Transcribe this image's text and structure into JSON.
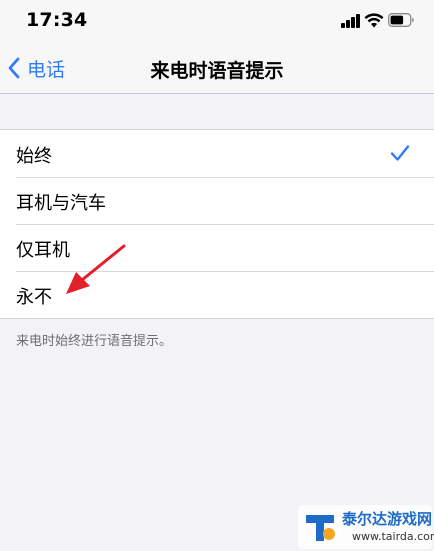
{
  "status_bar": {
    "time": "17:34",
    "icons": [
      "signal-icon",
      "wifi-icon",
      "battery-icon"
    ]
  },
  "nav": {
    "back_label": "电话",
    "title": "来电时语音提示"
  },
  "options": [
    {
      "label": "始终",
      "selected": true
    },
    {
      "label": "耳机与汽车",
      "selected": false
    },
    {
      "label": "仅耳机",
      "selected": false
    },
    {
      "label": "永不",
      "selected": false
    }
  ],
  "footer_note": "来电时始终进行语音提示。",
  "colors": {
    "accent": "#2f7cf6",
    "annotation": "#e3202a",
    "background": "#f2f2f7"
  },
  "watermark": {
    "name": "泰尔达游戏网",
    "url": "www.tairda.com"
  }
}
